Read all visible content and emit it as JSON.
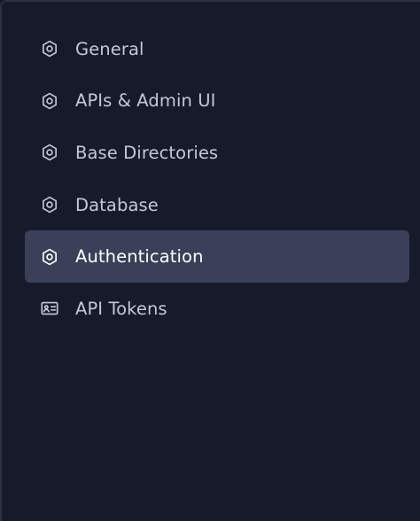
{
  "sidebar": {
    "items": [
      {
        "label": "General",
        "icon": "gear-icon",
        "active": false
      },
      {
        "label": "APIs & Admin UI",
        "icon": "gear-icon",
        "active": false
      },
      {
        "label": "Base Directories",
        "icon": "gear-icon",
        "active": false
      },
      {
        "label": "Database",
        "icon": "gear-icon",
        "active": false
      },
      {
        "label": "Authentication",
        "icon": "gear-icon",
        "active": true
      },
      {
        "label": "API Tokens",
        "icon": "id-card-icon",
        "active": false
      }
    ]
  },
  "colors": {
    "background": "#161a2b",
    "active_bg": "#394057",
    "text": "#c4c8d6",
    "active_text": "#ffffff"
  }
}
